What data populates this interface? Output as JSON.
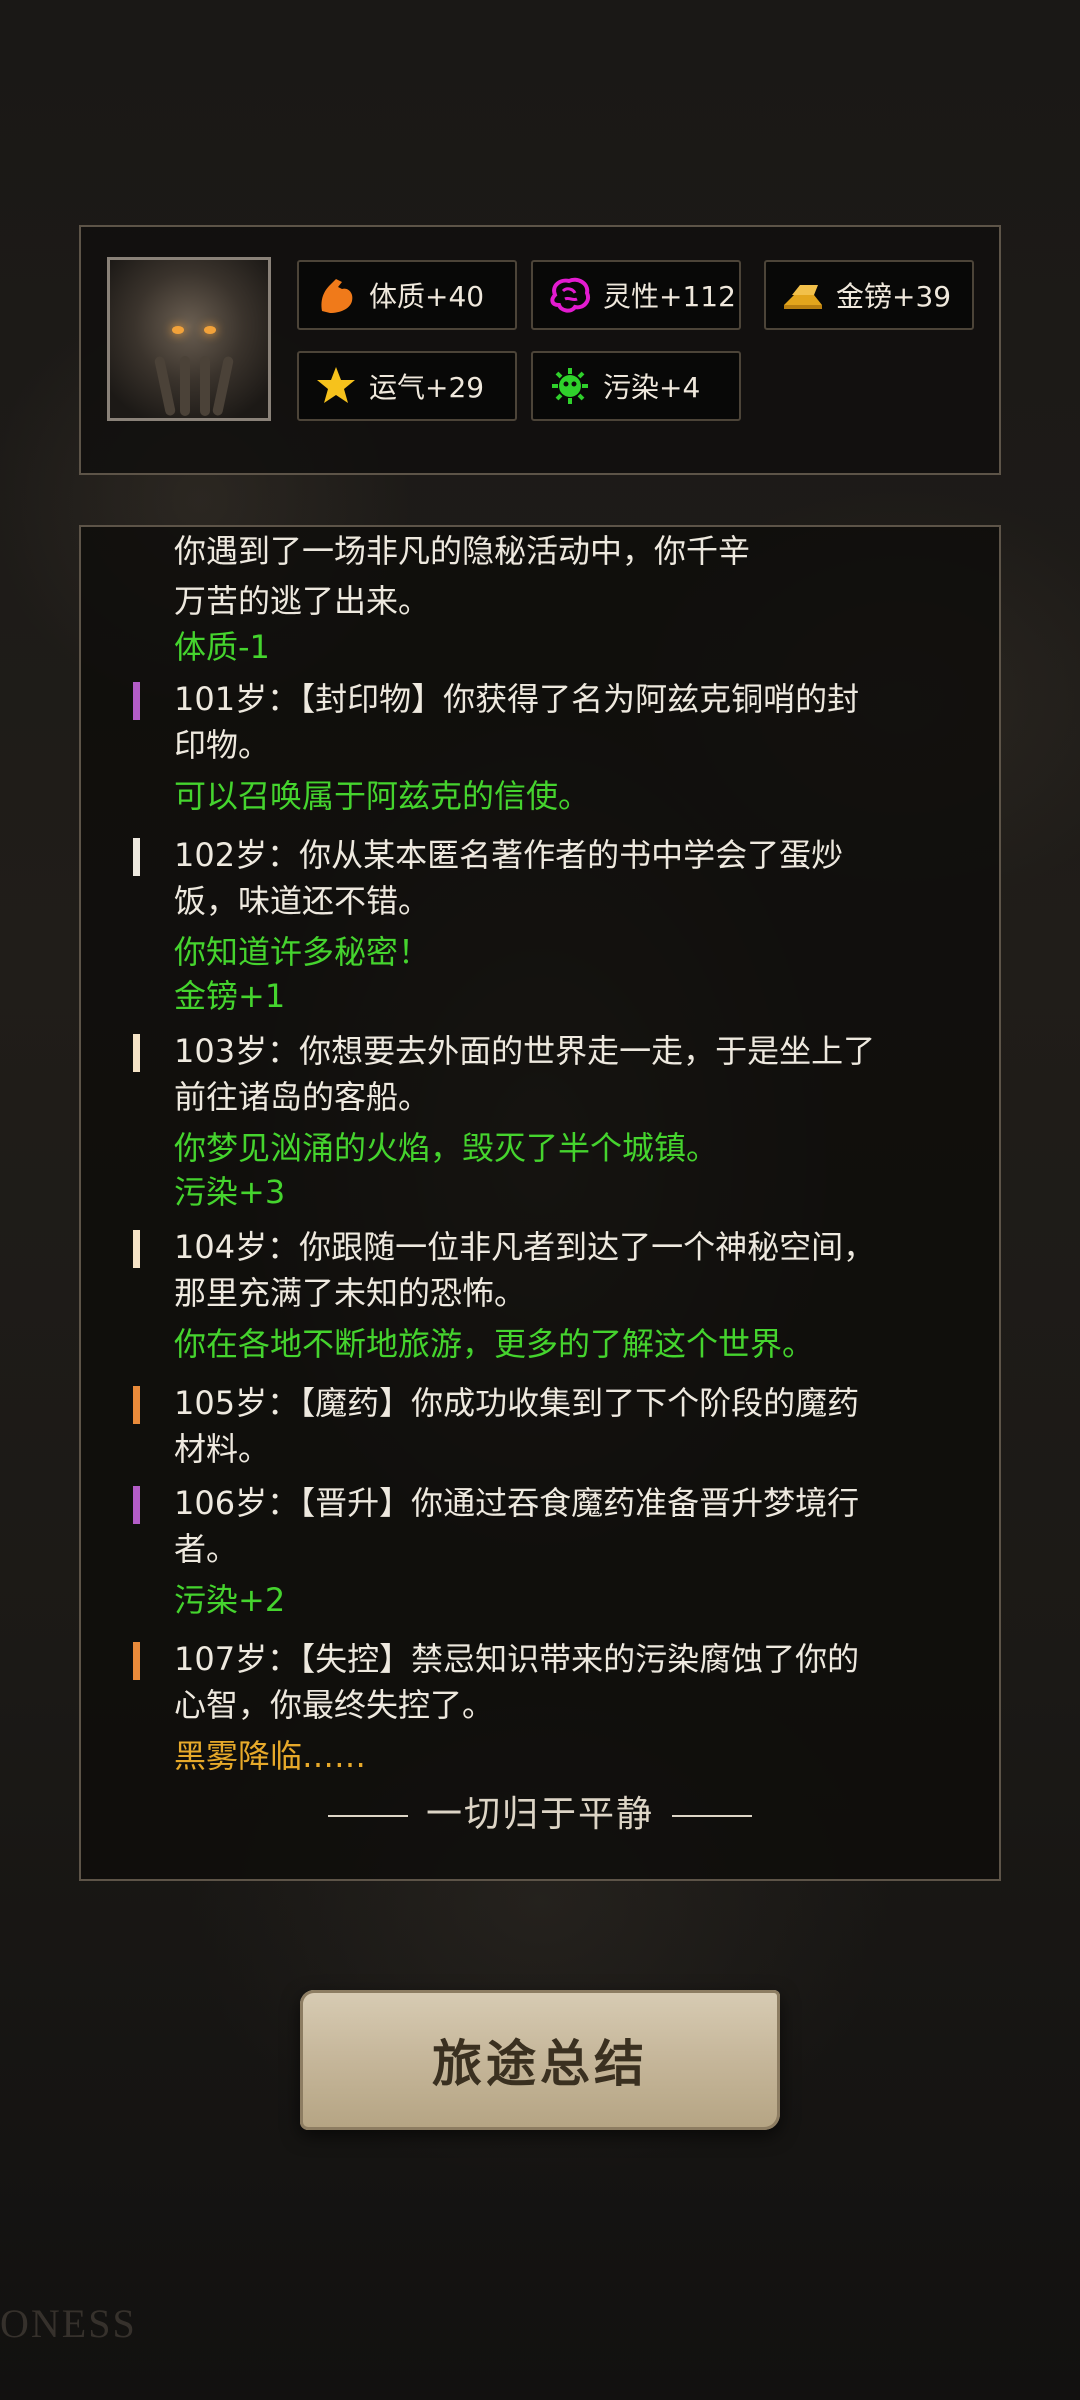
{
  "stats": [
    {
      "icon": "muscle-icon",
      "label": "体质+40",
      "color": "#f07a1a"
    },
    {
      "icon": "brain-icon",
      "label": "灵性+112",
      "color": "#e31bd0"
    },
    {
      "icon": "gold-bars-icon",
      "label": "金镑+39",
      "color": "#e3a51c"
    },
    {
      "icon": "star-icon",
      "label": "运气+29",
      "color": "#f6c21c"
    },
    {
      "icon": "virus-icon",
      "label": "污染+4",
      "color": "#2fd12b"
    }
  ],
  "log": {
    "lines": [
      {
        "text": "你遇到了一场非凡的隐秘活动中，你千辛",
        "style": "white"
      },
      {
        "text": "万苦的逃了出来。",
        "style": "white"
      },
      {
        "text": "体质-1",
        "style": "green"
      },
      {
        "text": "101岁：【封印物】你获得了名为阿兹克铜哨的封",
        "style": "white"
      },
      {
        "text": "印物。",
        "style": "white"
      },
      {
        "text": "可以召唤属于阿兹克的信使。",
        "style": "green"
      },
      {
        "text": "102岁：你从某本匿名著作者的书中学会了蛋炒",
        "style": "white"
      },
      {
        "text": "饭，味道还不错。",
        "style": "white"
      },
      {
        "text": "你知道许多秘密！",
        "style": "green"
      },
      {
        "text": "金镑+1",
        "style": "green"
      },
      {
        "text": "103岁：你想要去外面的世界走一走，于是坐上了",
        "style": "white"
      },
      {
        "text": "前往诸岛的客船。",
        "style": "white"
      },
      {
        "text": "你梦见汹涌的火焰，毁灭了半个城镇。",
        "style": "green"
      },
      {
        "text": "污染+3",
        "style": "green"
      },
      {
        "text": "104岁：你跟随一位非凡者到达了一个神秘空间，",
        "style": "white"
      },
      {
        "text": "那里充满了未知的恐怖。",
        "style": "white"
      },
      {
        "text": "你在各地不断地旅游，更多的了解这个世界。",
        "style": "green"
      },
      {
        "text": "105岁：【魔药】你成功收集到了下个阶段的魔药",
        "style": "white"
      },
      {
        "text": "材料。",
        "style": "white"
      },
      {
        "text": "106岁：【晋升】你通过吞食魔药准备晋升梦境行",
        "style": "white"
      },
      {
        "text": "者。",
        "style": "white"
      },
      {
        "text": "污染+2",
        "style": "green"
      },
      {
        "text": "107岁：【失控】禁忌知识带来的污染腐蚀了你的",
        "style": "white"
      },
      {
        "text": "心智，你最终失控了。",
        "style": "white"
      },
      {
        "text": "黑雾降临……",
        "style": "orange"
      }
    ],
    "markers": [
      {
        "color": "#b35cc7"
      },
      {
        "color": "#eee9df"
      },
      {
        "color": "#f5e3c6"
      },
      {
        "color": "#f5e3c6"
      },
      {
        "color": "#e98a3a"
      },
      {
        "color": "#b35cc7"
      },
      {
        "color": "#e98a3a"
      }
    ],
    "ending": "一切归于平静"
  },
  "summary_button": "旅途总结"
}
